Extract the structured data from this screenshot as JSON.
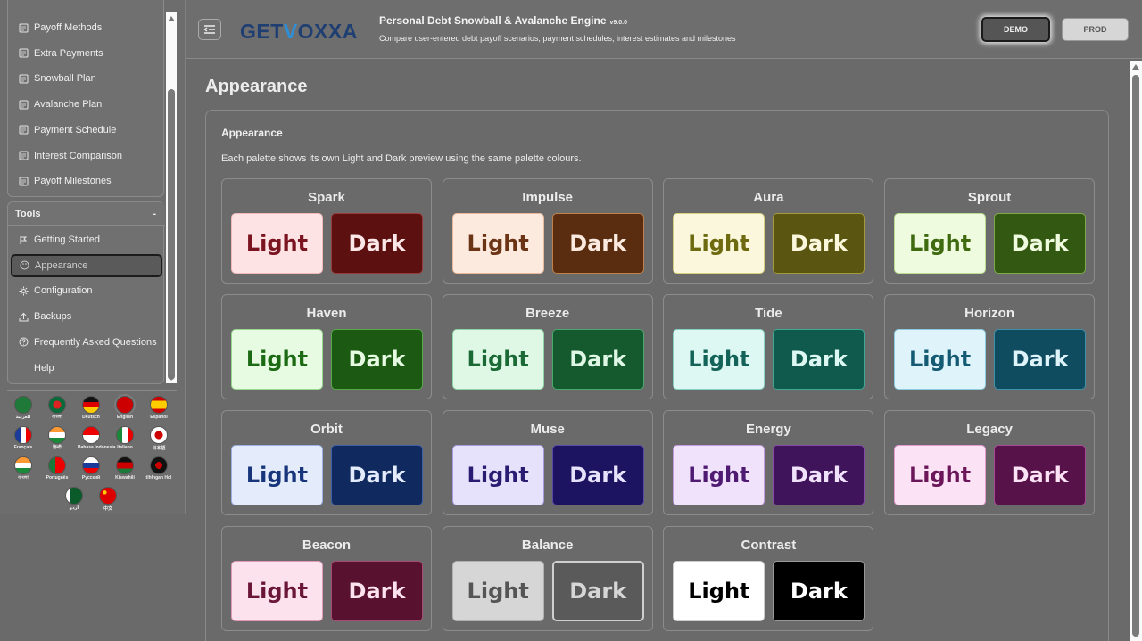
{
  "sidebar": {
    "nav_items": [
      {
        "label": "Payoff Methods"
      },
      {
        "label": "Extra Payments"
      },
      {
        "label": "Snowball Plan"
      },
      {
        "label": "Avalanche Plan"
      },
      {
        "label": "Payment Schedule"
      },
      {
        "label": "Interest Comparison"
      },
      {
        "label": "Payoff Milestones"
      }
    ],
    "tools_label": "Tools",
    "tools_toggle": "-",
    "tools_items": [
      {
        "label": "Getting Started",
        "icon": "play-icon"
      },
      {
        "label": "Appearance",
        "icon": "palette-icon",
        "active": true
      },
      {
        "label": "Configuration",
        "icon": "gear-icon"
      },
      {
        "label": "Backups",
        "icon": "upload-icon"
      },
      {
        "label": "Frequently Asked Questions",
        "icon": "question-icon"
      },
      {
        "label": "Help",
        "icon": ""
      }
    ],
    "languages": [
      {
        "name": "العربية"
      },
      {
        "name": "বাংলা"
      },
      {
        "name": "Deutsch"
      },
      {
        "name": "English"
      },
      {
        "name": "Español"
      },
      {
        "name": "Français"
      },
      {
        "name": "हिन्दी"
      },
      {
        "name": "Bahasa Indonesia"
      },
      {
        "name": "Italiano"
      },
      {
        "name": "日本語"
      },
      {
        "name": "বাংলা"
      },
      {
        "name": "Português"
      },
      {
        "name": "Русский"
      },
      {
        "name": "Kiswahili"
      },
      {
        "name": "tlhIngan Hol"
      },
      {
        "name": "اردو"
      },
      {
        "name": "中文"
      }
    ]
  },
  "header": {
    "logo_get": "GET",
    "logo_v": "V",
    "logo_rest": "OXXA",
    "title": "Personal Debt Snowball & Avalanche Engine",
    "version": "v9.0.0",
    "subtitle": "Compare user-entered debt payoff scenarios, payment schedules, interest estimates and milestones",
    "demo_label": "DEMO",
    "prod_label": "PROD"
  },
  "main": {
    "page_title": "Appearance",
    "panel_title": "Appearance",
    "panel_desc": "Each palette shows its own Light and Dark preview using the same palette colours.",
    "light_label": "Light",
    "dark_label": "Dark",
    "palettes": [
      {
        "name": "Spark",
        "light_bg": "#fde3e3",
        "light_fg": "#7a1420",
        "light_border": "#f0b8b8",
        "dark_bg": "#5c1010",
        "dark_fg": "#fbe7e7",
        "dark_border": "#9a3a3a"
      },
      {
        "name": "Impulse",
        "light_bg": "#fdeadf",
        "light_fg": "#6b3414",
        "light_border": "#e8b898",
        "dark_bg": "#5a2c10",
        "dark_fg": "#fbeadf",
        "dark_border": "#c0824a"
      },
      {
        "name": "Aura",
        "light_bg": "#fbf7dc",
        "light_fg": "#6e6a10",
        "light_border": "#d7cf7a",
        "dark_bg": "#5a5510",
        "dark_fg": "#fbf7dc",
        "dark_border": "#a39a3a"
      },
      {
        "name": "Sprout",
        "light_bg": "#effbdf",
        "light_fg": "#3f6a10",
        "light_border": "#b8dc90",
        "dark_bg": "#335812",
        "dark_fg": "#effbdf",
        "dark_border": "#7fa84a"
      },
      {
        "name": "Haven",
        "light_bg": "#e6fbe2",
        "light_fg": "#1d6a14",
        "light_border": "#9ad890",
        "dark_bg": "#1c5a14",
        "dark_fg": "#e6fbe2",
        "dark_border": "#58a84a"
      },
      {
        "name": "Breeze",
        "light_bg": "#dff8e6",
        "light_fg": "#1b6a36",
        "light_border": "#8ed4a6",
        "dark_bg": "#145a2e",
        "dark_fg": "#dff8e6",
        "dark_border": "#4aa86c"
      },
      {
        "name": "Tide",
        "light_bg": "#ddf8f3",
        "light_fg": "#136358",
        "light_border": "#86d2c4",
        "dark_bg": "#0f5a4c",
        "dark_fg": "#ddf8f3",
        "dark_border": "#3fa894"
      },
      {
        "name": "Horizon",
        "light_bg": "#dff3fb",
        "light_fg": "#145a72",
        "light_border": "#8ecbe0",
        "dark_bg": "#0f4c60",
        "dark_fg": "#dff3fb",
        "dark_border": "#3f90a8"
      },
      {
        "name": "Orbit",
        "light_bg": "#e4ebfb",
        "light_fg": "#17357a",
        "light_border": "#9ab0e0",
        "dark_bg": "#102a60",
        "dark_fg": "#e4ebfb",
        "dark_border": "#3f5ea8"
      },
      {
        "name": "Muse",
        "light_bg": "#e6e2fb",
        "light_fg": "#2a1c72",
        "light_border": "#a79ae0",
        "dark_bg": "#1c1460",
        "dark_fg": "#e6e2fb",
        "dark_border": "#5a4aa8"
      },
      {
        "name": "Energy",
        "light_bg": "#f1e2fb",
        "light_fg": "#4e1a72",
        "light_border": "#c39ae0",
        "dark_bg": "#40145a",
        "dark_fg": "#f1e2fb",
        "dark_border": "#834aa8"
      },
      {
        "name": "Legacy",
        "light_bg": "#fbe2f5",
        "light_fg": "#6a1658",
        "light_border": "#e09ad0",
        "dark_bg": "#58124a",
        "dark_fg": "#fbe2f5",
        "dark_border": "#a84a94"
      },
      {
        "name": "Beacon",
        "light_bg": "#fbe2ec",
        "light_fg": "#6a1638",
        "light_border": "#e09ab8",
        "dark_bg": "#581230",
        "dark_fg": "#fbe2ec",
        "dark_border": "#a84a74"
      },
      {
        "name": "Balance",
        "light_bg": "#d6d6d6",
        "light_fg": "#555555",
        "light_border": "#b0b0b0",
        "dark_bg": "#5a5a5a",
        "dark_fg": "#d6d6d6",
        "dark_border": "#cfcfcf"
      },
      {
        "name": "Contrast",
        "light_bg": "#ffffff",
        "light_fg": "#000000",
        "light_border": "#cccccc",
        "dark_bg": "#000000",
        "dark_fg": "#ffffff",
        "dark_border": "#999999"
      }
    ]
  }
}
